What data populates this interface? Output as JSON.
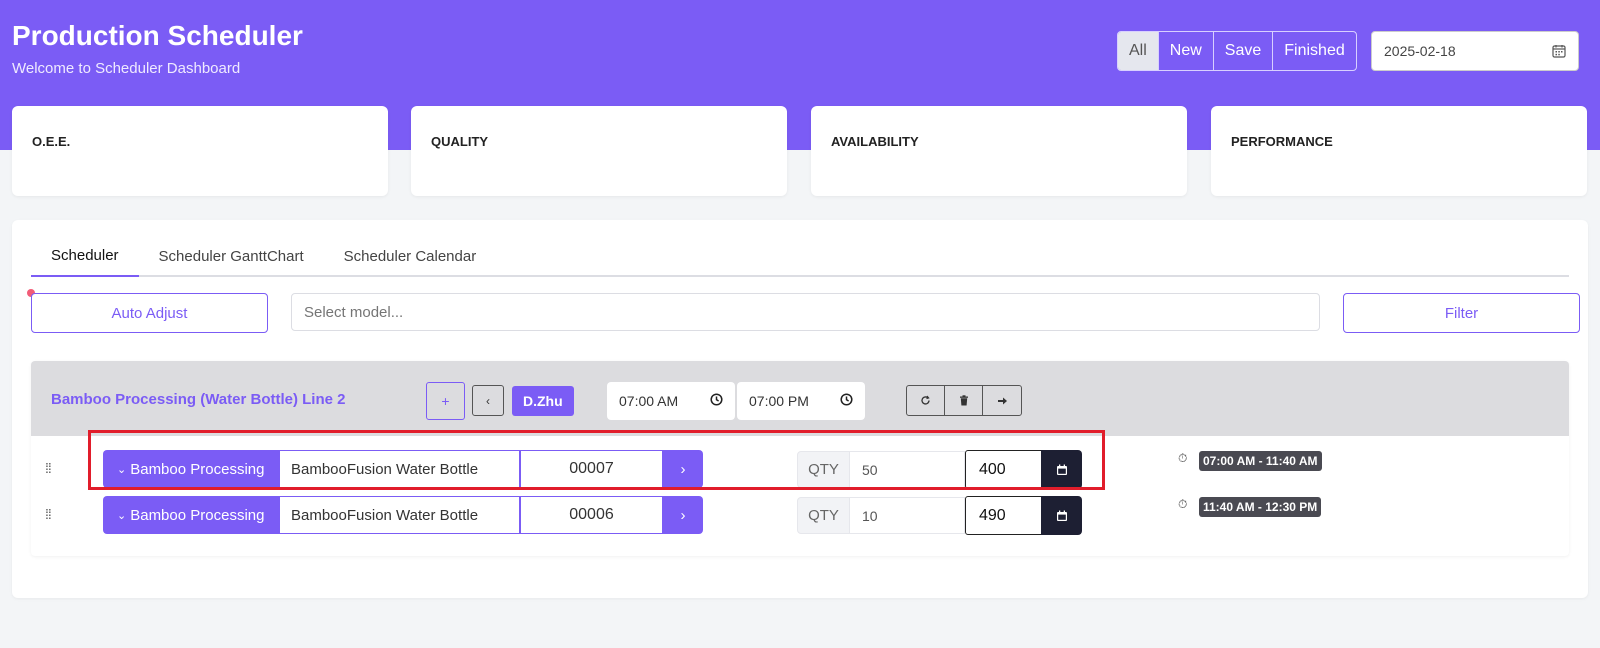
{
  "header": {
    "title": "Production Scheduler",
    "subtitle": "Welcome to Scheduler Dashboard",
    "status_filters": [
      "All",
      "New",
      "Save",
      "Finished"
    ],
    "active_filter": "All",
    "date": "2025-02-18"
  },
  "kpis": [
    {
      "label": "O.E.E."
    },
    {
      "label": "QUALITY"
    },
    {
      "label": "AVAILABILITY"
    },
    {
      "label": "PERFORMANCE"
    }
  ],
  "tabs": [
    {
      "label": "Scheduler",
      "active": true
    },
    {
      "label": "Scheduler GanttChart",
      "active": false
    },
    {
      "label": "Scheduler Calendar",
      "active": false
    }
  ],
  "toolbar": {
    "auto_adjust_label": "Auto Adjust",
    "model_placeholder": "Select model...",
    "filter_label": "Filter"
  },
  "line": {
    "title": "Bamboo Processing (Water Bottle) Line 2",
    "plus_label": "+",
    "prev_label": "‹",
    "operator": "D.Zhu",
    "start_time": "07:00 AM",
    "end_time": "07:00 PM",
    "jobs": [
      {
        "process": "Bamboo Processing",
        "product": "BambooFusion Water Bottle",
        "order": "00007",
        "qty_label": "QTY",
        "qty_done": "50",
        "qty_total": "400",
        "time_range": "07:00 AM - 11:40 AM"
      },
      {
        "process": "Bamboo Processing",
        "product": "BambooFusion Water Bottle",
        "order": "00006",
        "qty_label": "QTY",
        "qty_done": "10",
        "qty_total": "490",
        "time_range": "11:40 AM - 12:30 PM"
      }
    ]
  },
  "colors": {
    "brand": "#7b5cf5",
    "highlight": "#e11d2b",
    "dark_button": "#1d1f33"
  }
}
